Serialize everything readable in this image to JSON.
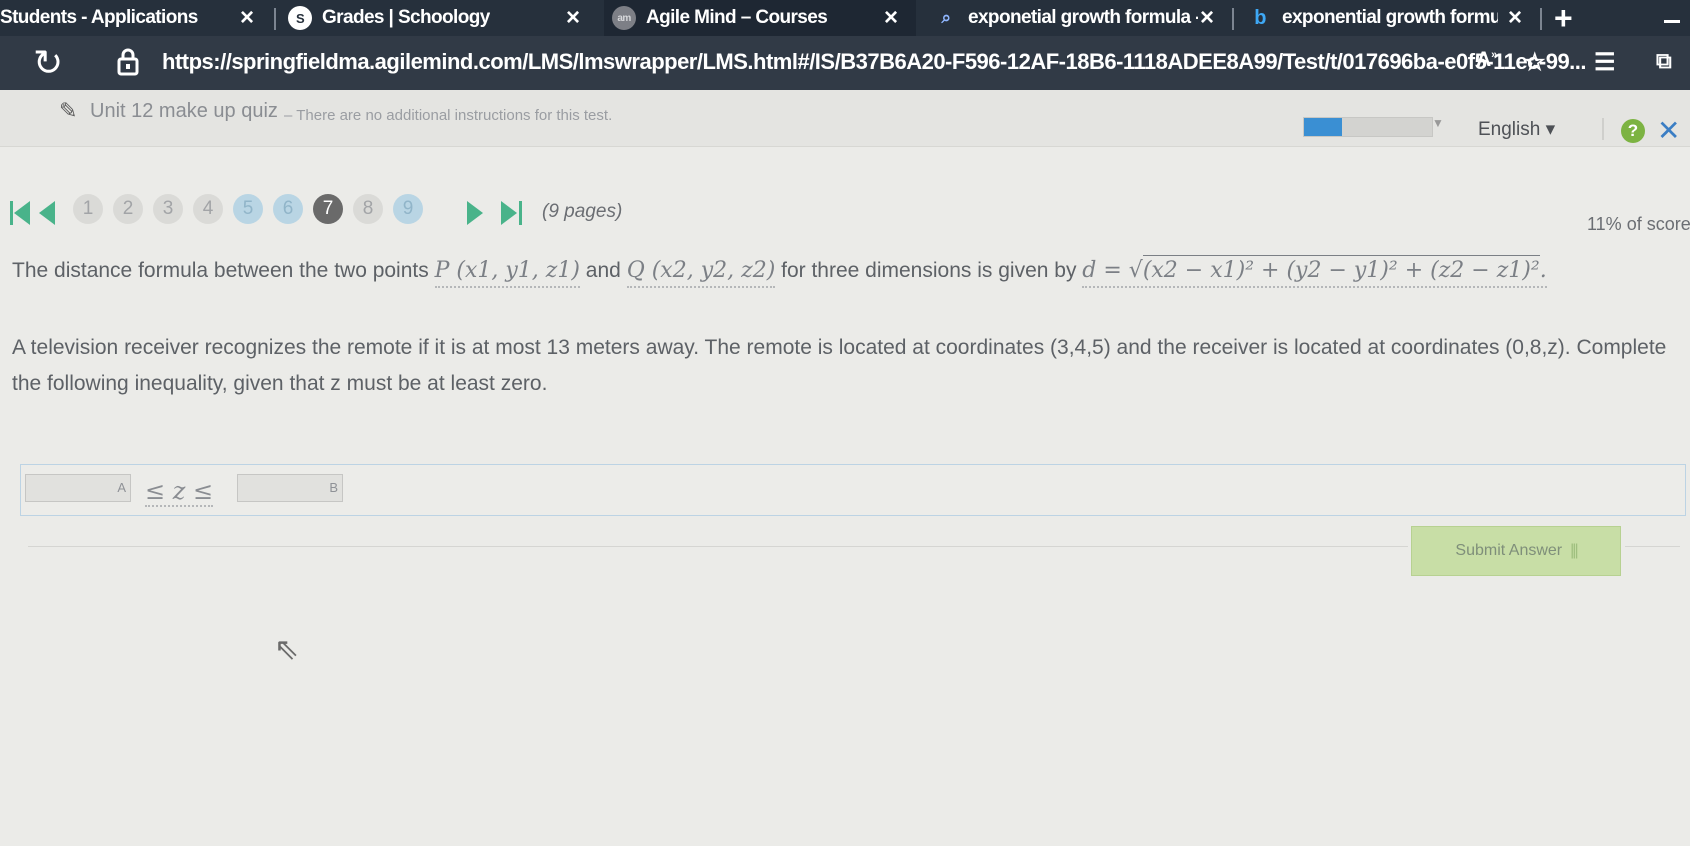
{
  "browser": {
    "tabs": [
      {
        "title": "Students - Applications",
        "icon": "none",
        "active": false
      },
      {
        "title": "Grades | Schoology",
        "icon": "schoology-icon",
        "active": false
      },
      {
        "title": "Agile Mind – Courses",
        "icon": "agilemind-icon",
        "active": true
      },
      {
        "title": "exponetial growth formula - ",
        "icon": "search-icon",
        "active": false
      },
      {
        "title": "exponential growth formula",
        "icon": "bing-icon",
        "active": false
      }
    ],
    "url": "https://springfieldma.agilemind.com/LMS/lmswrapper/LMS.html#/IS/B37B6A20-F596-12AF-18B6-1118ADEE8A99/Test/t/017696ba-e0f5-11ec-99..."
  },
  "quiz": {
    "title": "Unit 12 make up quiz",
    "instructions": "– There are no additional instructions for this test.",
    "progress_fraction": 0.3,
    "language": "English",
    "pages": [
      "1",
      "2",
      "3",
      "4",
      "5",
      "6",
      "7",
      "8",
      "9"
    ],
    "answered_pages": [
      "5",
      "6",
      "9"
    ],
    "current_page": "7",
    "pages_count": "(9 pages)",
    "score": "11% of score"
  },
  "question": {
    "line1_pre": "The distance formula between the two points",
    "point_p": "P (x1, y1, z1)",
    "and": "and",
    "point_q": "Q (x2, y2, z2)",
    "line1_mid": "for three dimensions is given by",
    "formula_lhs": "d =",
    "formula_rad": "(x2 − x1)² + (y2 − y1)² + (z2 − z1)²",
    "formula_end": ".",
    "text": "A television receiver recognizes the remote if it is at most 13 meters away. The remote is located at coordinates (3,4,5) and the receiver is located at coordinates (0,8,z). Complete the following inequality, given that z must be at least zero."
  },
  "answer": {
    "input_a_label": "A",
    "input_a_value": "",
    "inequality": "≤ z ≤",
    "input_b_label": "B",
    "input_b_value": ""
  },
  "submit_label": "Submit Answer",
  "colors": {
    "accent": "#3b7ec4",
    "submit_bg": "#c8dea6",
    "help": "#7cb342"
  }
}
